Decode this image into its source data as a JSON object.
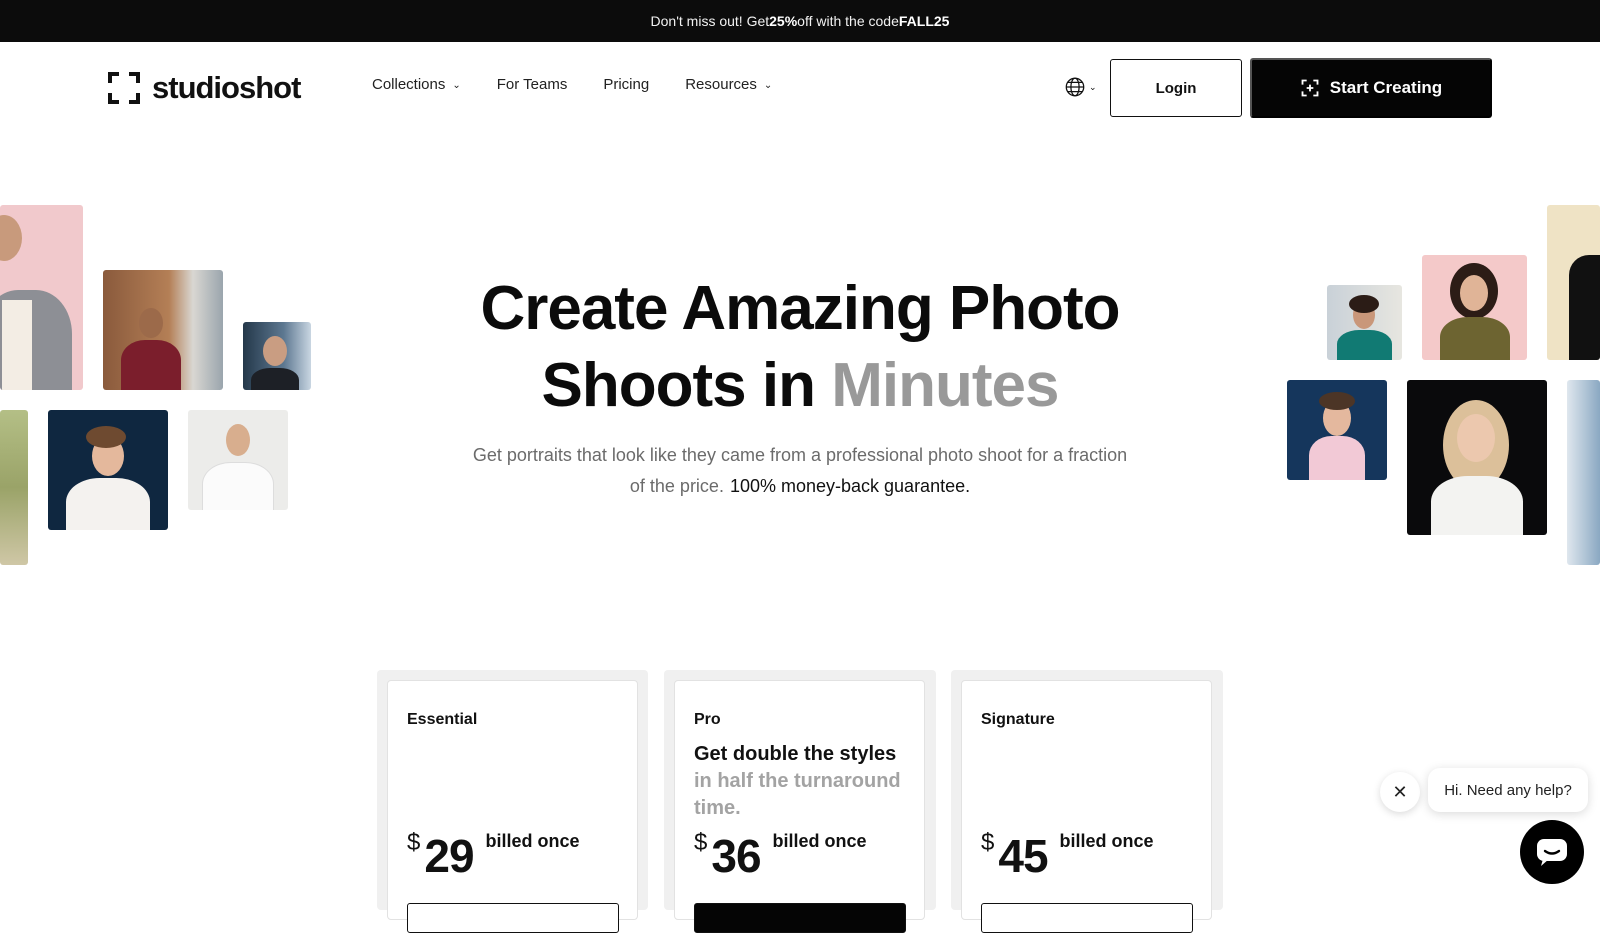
{
  "promo": {
    "prefix": "Don't miss out! Get ",
    "discount": "25%",
    "middle": " off with the code ",
    "code": "FALL25"
  },
  "header": {
    "logo_text": "studioshot",
    "nav": [
      {
        "label": "Collections",
        "has_dropdown": true
      },
      {
        "label": "For Teams",
        "has_dropdown": false
      },
      {
        "label": "Pricing",
        "has_dropdown": false
      },
      {
        "label": "Resources",
        "has_dropdown": true
      }
    ],
    "login_label": "Login",
    "cta_label": "Start Creating"
  },
  "hero": {
    "title_line1": "Create Amazing Photo",
    "title_line2_prefix": "Shoots in ",
    "title_line2_accent": "Minutes",
    "subtitle": "Get portraits that look like they came from a professional photo shoot for a fraction of the price.",
    "guarantee": "100% money-back guarantee."
  },
  "pricing": {
    "plans": [
      {
        "name": "Essential",
        "tagline": "",
        "tagline_muted": "",
        "currency": "$",
        "price": "29",
        "note": "billed once"
      },
      {
        "name": "Pro",
        "tagline": "Get double the styles",
        "tagline_muted": "in half the turnaround time.",
        "currency": "$",
        "price": "36",
        "note": "billed once"
      },
      {
        "name": "Signature",
        "tagline": "",
        "tagline_muted": "",
        "currency": "$",
        "price": "45",
        "note": "billed once"
      }
    ]
  },
  "chat": {
    "greeting": "Hi. Need any help?",
    "close_icon": "close-icon",
    "launcher_icon": "chat-icon"
  },
  "colors": {
    "promo_bg": "#0c0c0c",
    "accent_gray": "#999999",
    "cta_bg": "#050505"
  }
}
